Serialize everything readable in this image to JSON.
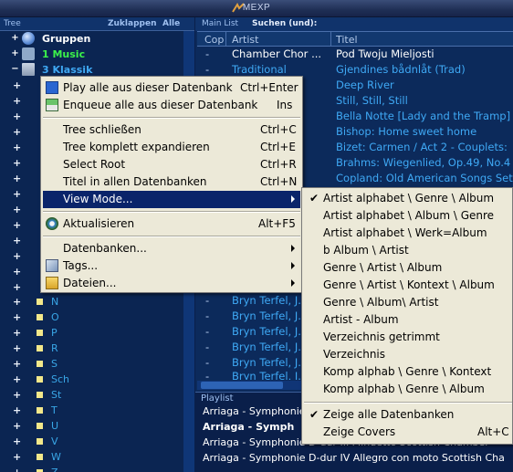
{
  "app": {
    "title": "MEXP"
  },
  "tree": {
    "header": {
      "title": "Tree",
      "collapse": "Zuklappen",
      "all": "Alle"
    },
    "nodes": [
      {
        "label": "Gruppen",
        "color": "#ffffff",
        "icon": "globe-icon"
      },
      {
        "label": "1 Music",
        "color": "#3cf24a",
        "icon": "music-icon"
      },
      {
        "label": "3 Klassik",
        "color": "#3fa9f5",
        "icon": "stack-icon"
      }
    ],
    "letters": [
      "N",
      "O",
      "P",
      "R",
      "S",
      "Sch",
      "St",
      "T",
      "U",
      "V",
      "W",
      "Z"
    ]
  },
  "main": {
    "header": {
      "title": "Main List",
      "search": "Suchen (und):"
    },
    "columns": {
      "cop": "Cop",
      "artist": "Artist",
      "title": "Titel"
    },
    "rows": [
      {
        "cop": "-",
        "artist": "Chamber Chor ...",
        "title": "Pod Twoju Mieljosti"
      },
      {
        "cop": "-",
        "artist": "Traditional",
        "title": "Gjendines bådnlåt (Trad)"
      },
      {
        "cop": "",
        "artist": "",
        "title": "Deep River"
      },
      {
        "cop": "",
        "artist": "",
        "title": "Still, Still, Still"
      },
      {
        "cop": "",
        "artist": "",
        "title": "Bella Notte [Lady and the Tramp]"
      },
      {
        "cop": "",
        "artist": "",
        "title": "Bishop: Home sweet home"
      },
      {
        "cop": "",
        "artist": "",
        "title": "Bizet: Carmen / Act 2 - Couplets:"
      },
      {
        "cop": "",
        "artist": "",
        "title": "Brahms: Wiegenlied, Op.49, No.4"
      },
      {
        "cop": "",
        "artist": "",
        "title": "Copland: Old American Songs Set"
      },
      {
        "cop": "-",
        "artist": "Bryn Terfel, J...",
        "title": ""
      },
      {
        "cop": "-",
        "artist": "Bryn Terfel, J...",
        "title": ""
      },
      {
        "cop": "-",
        "artist": "Bryn Terfel, J...",
        "title": ""
      },
      {
        "cop": "-",
        "artist": "Bryn Terfel, J...",
        "title": ""
      },
      {
        "cop": "-",
        "artist": "Bryn Terfel, J...",
        "title": ""
      },
      {
        "cop": "-",
        "artist": "Bryn Terfel, J...",
        "title": ""
      }
    ]
  },
  "playlist": {
    "header": "Playlist",
    "rows": [
      {
        "text": "Arriaga - Symphonie",
        "bold": false
      },
      {
        "text": "Arriaga - Symph",
        "bold": true
      },
      {
        "text": "Arriaga - Symphonie D-dur III Minuetto Scottish Chamber",
        "bold": false
      },
      {
        "text": "Arriaga - Symphonie D-dur IV Allegro con moto Scottish Cha",
        "bold": false
      }
    ]
  },
  "context_menu": {
    "items": [
      {
        "label": "Play alle aus dieser Datenbank",
        "shortcut": "Ctrl+Enter",
        "icon": "play-icon"
      },
      {
        "label": "Enqueue alle aus dieser Datenbank",
        "shortcut": "Ins",
        "icon": "enqueue-icon"
      },
      {
        "label": "Tree schließen",
        "shortcut": "Ctrl+C"
      },
      {
        "label": "Tree komplett expandieren",
        "shortcut": "Ctrl+E"
      },
      {
        "label": "Select Root",
        "shortcut": "Ctrl+R"
      },
      {
        "label": "Titel in allen Datenbanken",
        "shortcut": "Ctrl+N"
      },
      {
        "label": "View Mode...",
        "shortcut": ""
      },
      {
        "label": "Aktualisieren",
        "shortcut": "Alt+F5",
        "icon": "refresh-icon"
      },
      {
        "label": "Datenbanken...",
        "shortcut": ""
      },
      {
        "label": "Tags...",
        "shortcut": "",
        "icon": "tags-icon"
      },
      {
        "label": "Dateien...",
        "shortcut": "",
        "icon": "folder-icon"
      }
    ]
  },
  "submenu": {
    "items": [
      {
        "label": "Artist alphabet \\ Genre \\ Album",
        "checked": true
      },
      {
        "label": "Artist alphabet \\ Album \\ Genre",
        "checked": false
      },
      {
        "label": "Artist alphabet \\ Werk=Album",
        "checked": false
      },
      {
        "label": "b Album \\ Artist",
        "checked": false
      },
      {
        "label": "Genre \\ Artist \\ Album",
        "checked": false
      },
      {
        "label": "Genre \\ Artist \\ Kontext \\ Album",
        "checked": false
      },
      {
        "label": "Genre \\ Album\\ Artist",
        "checked": false
      },
      {
        "label": "Artist - Album",
        "checked": false
      },
      {
        "label": "Verzeichnis getrimmt",
        "checked": false
      },
      {
        "label": "Verzeichnis",
        "checked": false
      },
      {
        "label": "Komp alphab \\ Genre \\ Kontext",
        "checked": false
      },
      {
        "label": "Komp alphab \\ Genre \\ Album",
        "checked": false
      },
      {
        "label": "Zeige alle Datenbanken",
        "checked": true,
        "shortcut": ""
      },
      {
        "label": "Zeige Covers",
        "checked": false,
        "shortcut": "Alt+C"
      }
    ]
  }
}
